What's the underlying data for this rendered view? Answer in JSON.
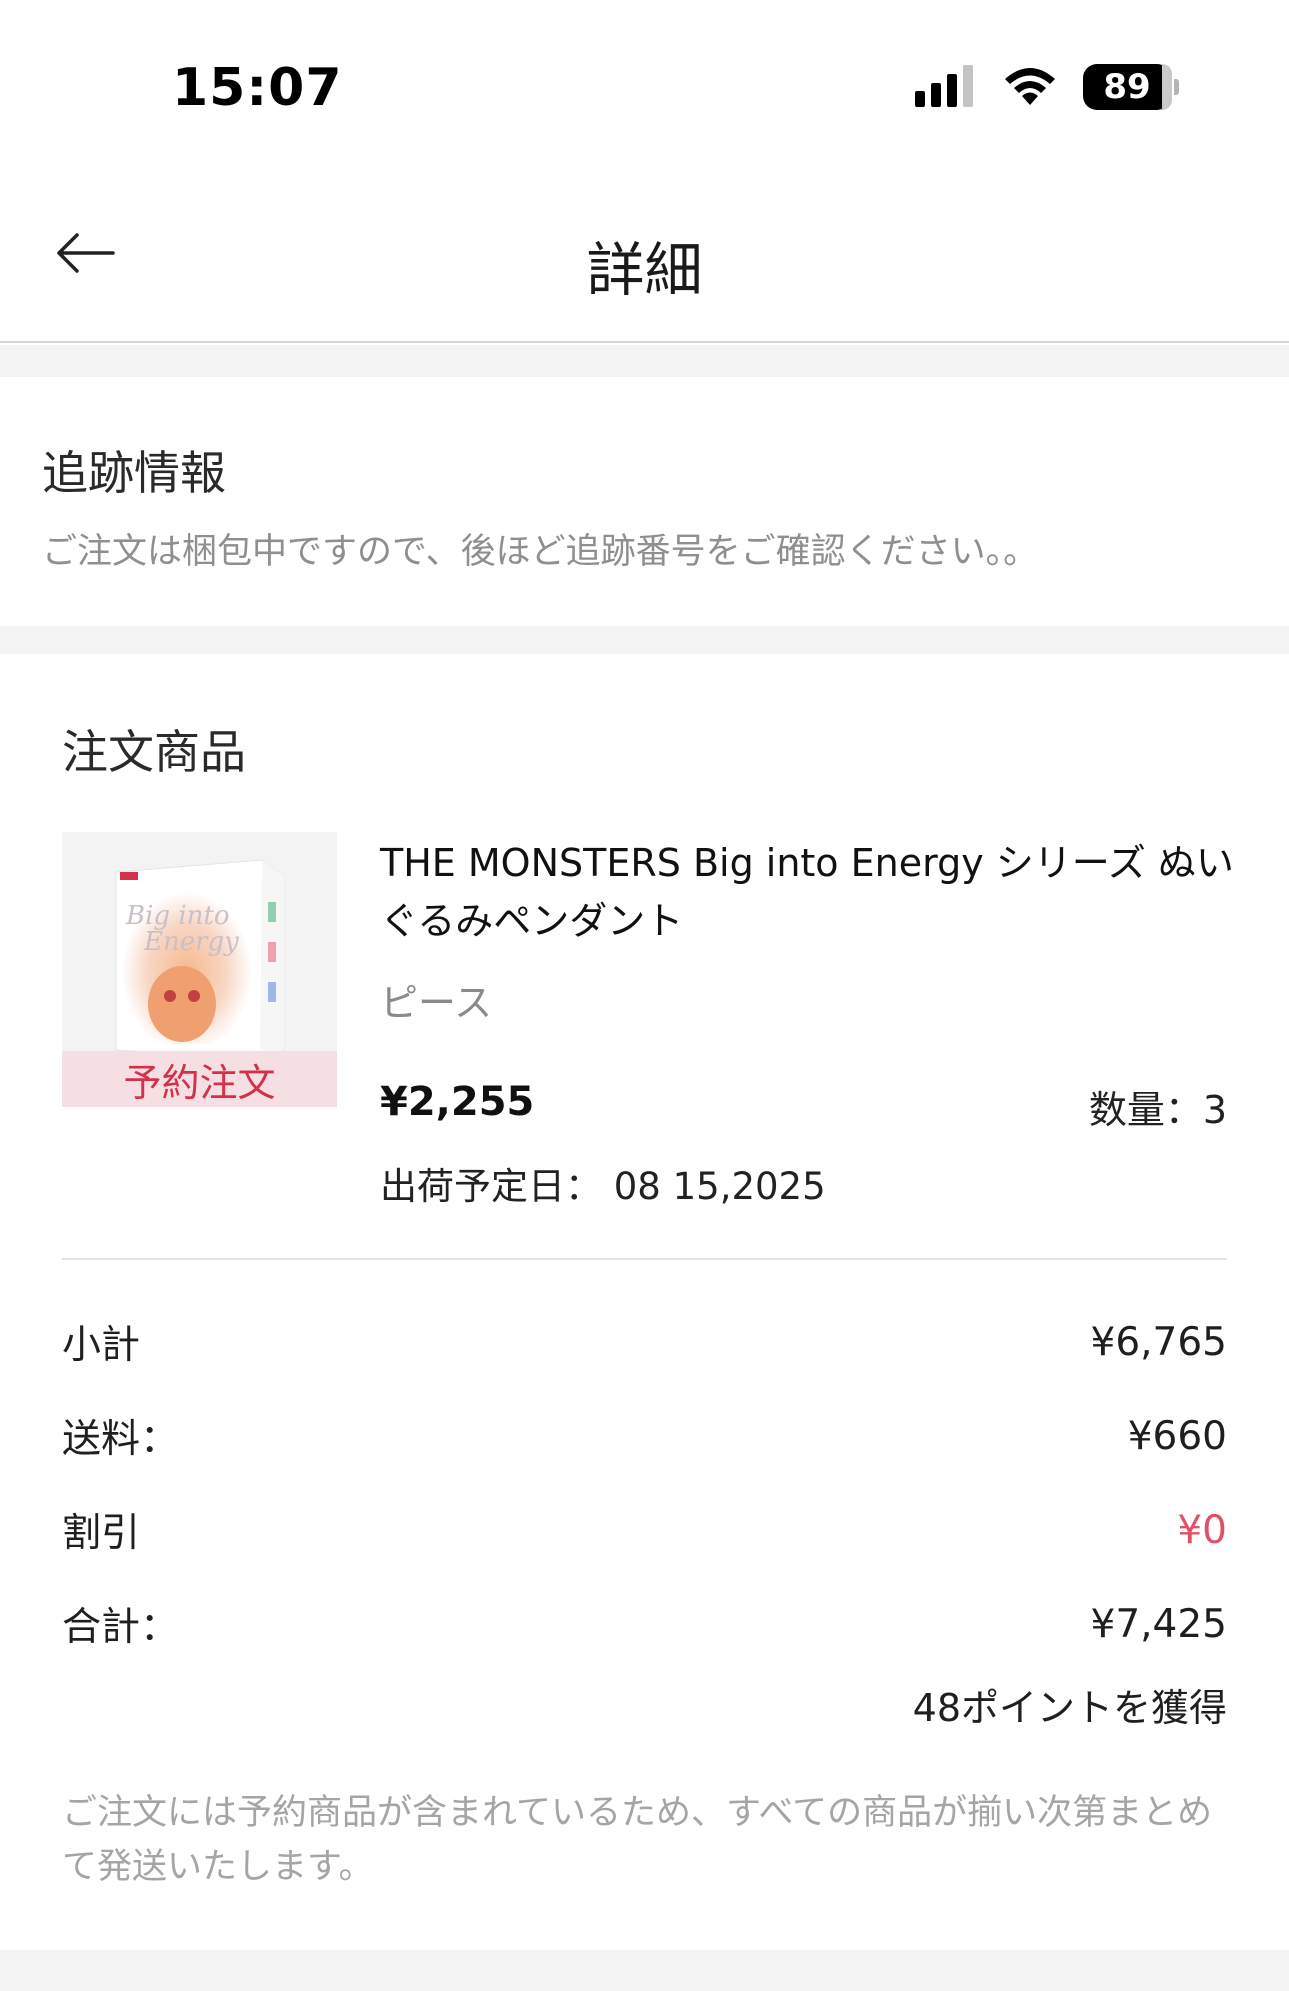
{
  "status_bar": {
    "time": "15:07",
    "battery_level": "89",
    "signal_icon": "cellular-signal-icon",
    "wifi_icon": "wifi-icon"
  },
  "header": {
    "title": "詳細",
    "back_icon": "arrow-left-icon"
  },
  "tracking": {
    "title": "追跡情報",
    "message": "ご注文は梱包中ですので、後ほど追跡番号をご確認ください。。"
  },
  "order": {
    "section_title": "注文商品",
    "item": {
      "name": "THE MONSTERS Big into Energy シリーズ ぬいぐるみペンダント",
      "variant": "ピース",
      "badge": "予約注文",
      "price": "¥2,255",
      "quantity_label": "数量：3",
      "ship_date_label": "出荷予定日：",
      "ship_date": "08 15,2025"
    },
    "summary": {
      "subtotal_label": "小計",
      "subtotal_value": "¥6,765",
      "shipping_label": "送料：",
      "shipping_value": "¥660",
      "discount_label": "割引",
      "discount_value": "¥0",
      "total_label": "合計：",
      "total_value": "¥7,425",
      "points": "48ポイントを獲得"
    },
    "note": "ご注文には予約商品が含まれているため、すべての商品が揃い次第まとめて発送いたします。"
  },
  "colors": {
    "accent_red": "#d5304a",
    "discount_red": "#e05068",
    "band_gray": "#f3f3f3"
  }
}
